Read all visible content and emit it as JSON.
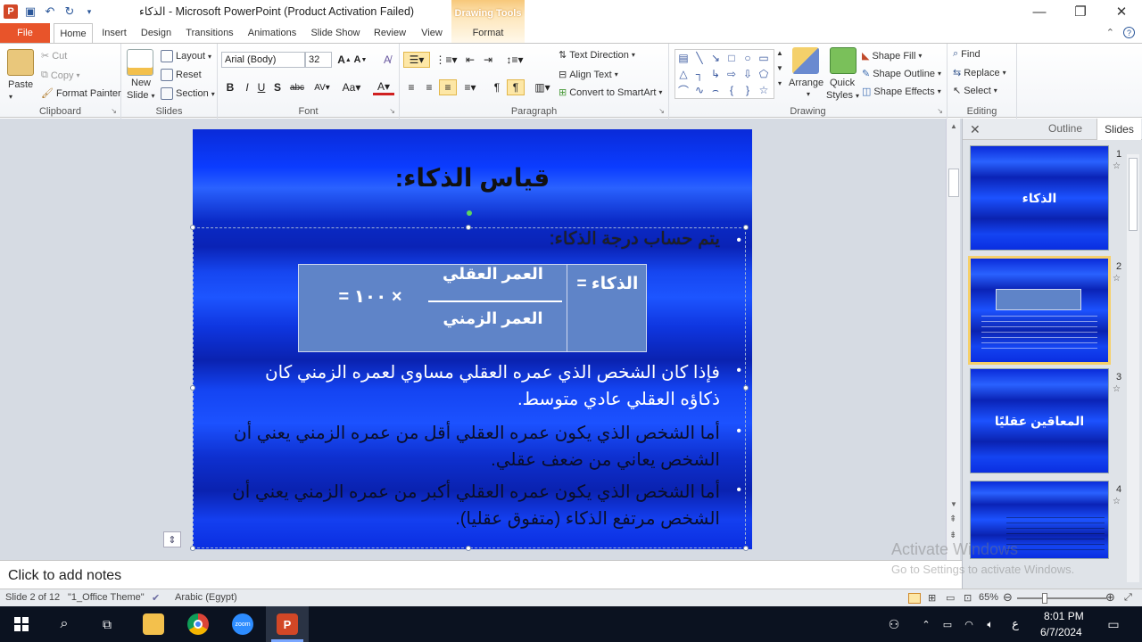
{
  "window": {
    "title": "الذكاء  -  Microsoft PowerPoint (Product Activation Failed)"
  },
  "tabs": {
    "file": "File",
    "home": "Home",
    "insert": "Insert",
    "design": "Design",
    "transitions": "Transitions",
    "animations": "Animations",
    "slide_show": "Slide Show",
    "review": "Review",
    "view": "View",
    "drawing_tools": "Drawing Tools",
    "format": "Format"
  },
  "ribbon": {
    "clipboard": {
      "label": "Clipboard",
      "paste": "Paste",
      "cut": "Cut",
      "copy": "Copy",
      "format_painter": "Format Painter"
    },
    "slides": {
      "label": "Slides",
      "new_slide_1": "New",
      "new_slide_2": "Slide",
      "layout": "Layout",
      "reset": "Reset",
      "section": "Section"
    },
    "font": {
      "label": "Font",
      "family": "Arial (Body)",
      "size": "32"
    },
    "paragraph": {
      "label": "Paragraph",
      "text_direction": "Text Direction",
      "align_text": "Align Text",
      "convert_smartart": "Convert to SmartArt"
    },
    "drawing": {
      "label": "Drawing",
      "arrange": "Arrange",
      "quick_styles_1": "Quick",
      "quick_styles_2": "Styles",
      "shape_fill": "Shape Fill",
      "shape_outline": "Shape Outline",
      "shape_effects": "Shape Effects"
    },
    "editing": {
      "label": "Editing",
      "find": "Find",
      "replace": "Replace",
      "select": "Select"
    }
  },
  "slide": {
    "title": "قياس الذكاء:",
    "bullet1": "يتم حساب درجة الذكاء:",
    "formula": {
      "lhs": "الذكاء =",
      "numerator": "العمر العقلي",
      "denominator": "العمر الزمني",
      "multiplier": "× ١٠٠ ="
    },
    "bullet2": "فإذا كان الشخص الذي عمره العقلي مساوي لعمره الزمني كان ذكاؤه العقلي عادي متوسط.",
    "bullet3": "أما الشخص الذي يكون عمره العقلي أقل من عمره الزمني يعني أن الشخص يعاني من ضعف عقلي.",
    "bullet4": "أما الشخص الذي يكون عمره العقلي أكبر من عمره الزمني يعني أن الشخص مرتفع الذكاء (متفوق عقليا)."
  },
  "pane": {
    "outline_tab": "Outline",
    "slides_tab": "Slides",
    "thumbs": [
      {
        "num": "1",
        "title": "الذكاء"
      },
      {
        "num": "2",
        "title": ""
      },
      {
        "num": "3",
        "title": "المعاقين عقليًا"
      },
      {
        "num": "4",
        "title": ""
      }
    ]
  },
  "notes": {
    "placeholder": "Click to add notes"
  },
  "status": {
    "slide_of": "Slide 2 of 12",
    "theme": "\"1_Office Theme\"",
    "language": "Arabic (Egypt)",
    "zoom": "65%"
  },
  "watermark": {
    "line1": "Activate Windows",
    "line2": "Go to Settings to activate Windows."
  },
  "taskbar": {
    "time": "8:01 PM",
    "date": "6/7/2024",
    "lang": "ع"
  }
}
